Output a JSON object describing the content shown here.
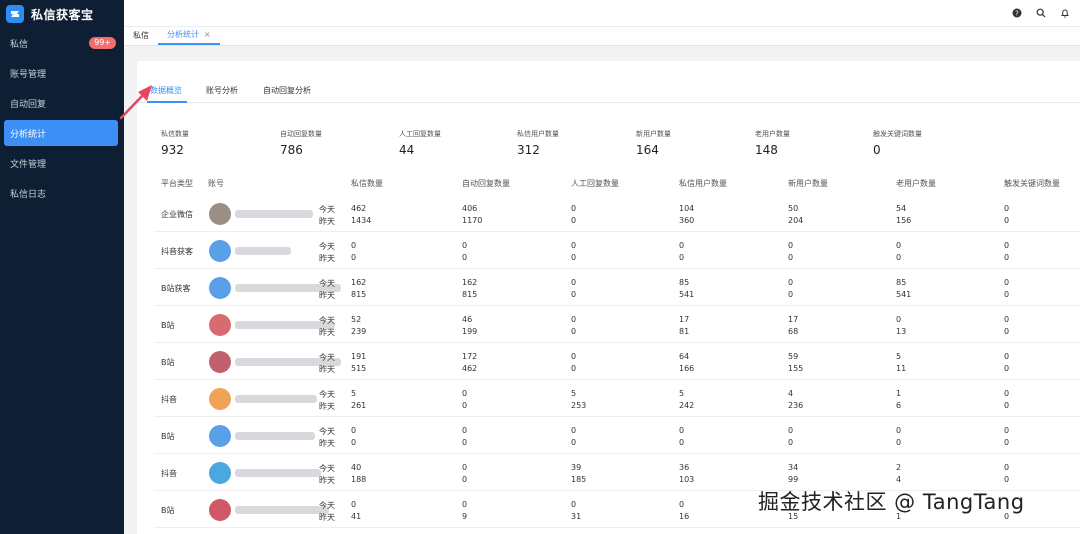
{
  "app": {
    "title": "私信获客宝",
    "accent": "#3c8ff5",
    "sidebar_bg": "#0f1f33"
  },
  "sidebar": {
    "items": [
      {
        "label": "私信",
        "badge": "99+",
        "active": false
      },
      {
        "label": "账号管理",
        "active": false
      },
      {
        "label": "自动回复",
        "active": false
      },
      {
        "label": "分析统计",
        "active": true
      },
      {
        "label": "文件管理",
        "active": false
      },
      {
        "label": "私信日志",
        "active": false
      }
    ]
  },
  "topbar": {
    "icons": [
      "help-icon",
      "search-icon",
      "bell-icon"
    ]
  },
  "tabstrip": {
    "tabs": [
      {
        "label": "私信",
        "active": false
      },
      {
        "label": "分析统计",
        "active": true,
        "closable": true
      }
    ],
    "close_glyph": "×"
  },
  "subtabs": [
    {
      "label": "数据概览",
      "active": true
    },
    {
      "label": "账号分析",
      "active": false
    },
    {
      "label": "自动回复分析",
      "active": false
    }
  ],
  "stats": [
    {
      "label": "私信数量",
      "value": "932"
    },
    {
      "label": "自动回复数量",
      "value": "786"
    },
    {
      "label": "人工回复数量",
      "value": "44"
    },
    {
      "label": "私信用户数量",
      "value": "312"
    },
    {
      "label": "新用户数量",
      "value": "164"
    },
    {
      "label": "老用户数量",
      "value": "148"
    },
    {
      "label": "触发关键词数量",
      "value": "0"
    }
  ],
  "table": {
    "headers": [
      "平台类型",
      "账号",
      "私信数量",
      "自动回复数量",
      "人工回复数量",
      "私信用户数量",
      "新用户数量",
      "老用户数量",
      "触发关键词数量"
    ],
    "day_labels": [
      "今天",
      "昨天"
    ],
    "rows": [
      {
        "platform": "企业微信",
        "today": [
          "462",
          "406",
          "0",
          "104",
          "50",
          "54",
          "0"
        ],
        "yesterday": [
          "1434",
          "1170",
          "0",
          "360",
          "204",
          "156",
          "0"
        ]
      },
      {
        "platform": "抖音获客",
        "today": [
          "0",
          "0",
          "0",
          "0",
          "0",
          "0",
          "0"
        ],
        "yesterday": [
          "0",
          "0",
          "0",
          "0",
          "0",
          "0",
          "0"
        ]
      },
      {
        "platform": "B站获客",
        "today": [
          "162",
          "162",
          "0",
          "85",
          "0",
          "85",
          "0"
        ],
        "yesterday": [
          "815",
          "815",
          "0",
          "541",
          "0",
          "541",
          "0"
        ]
      },
      {
        "platform": "B站",
        "today": [
          "52",
          "46",
          "0",
          "17",
          "17",
          "0",
          "0"
        ],
        "yesterday": [
          "239",
          "199",
          "0",
          "81",
          "68",
          "13",
          "0"
        ]
      },
      {
        "platform": "B站",
        "today": [
          "191",
          "172",
          "0",
          "64",
          "59",
          "5",
          "0"
        ],
        "yesterday": [
          "515",
          "462",
          "0",
          "166",
          "155",
          "11",
          "0"
        ]
      },
      {
        "platform": "抖音",
        "today": [
          "5",
          "0",
          "5",
          "5",
          "4",
          "1",
          "0"
        ],
        "yesterday": [
          "261",
          "0",
          "253",
          "242",
          "236",
          "6",
          "0"
        ]
      },
      {
        "platform": "B站",
        "today": [
          "0",
          "0",
          "0",
          "0",
          "0",
          "0",
          "0"
        ],
        "yesterday": [
          "0",
          "0",
          "0",
          "0",
          "0",
          "0",
          "0"
        ]
      },
      {
        "platform": "抖音",
        "today": [
          "40",
          "0",
          "39",
          "36",
          "34",
          "2",
          "0"
        ],
        "yesterday": [
          "188",
          "0",
          "185",
          "103",
          "99",
          "4",
          "0"
        ]
      },
      {
        "platform": "B站",
        "today": [
          "0",
          "0",
          "0",
          "0",
          "",
          "",
          ""
        ],
        "yesterday": [
          "41",
          "9",
          "31",
          "16",
          "15",
          "1",
          "0"
        ]
      }
    ]
  },
  "watermark": "掘金技术社区 @ TangTang"
}
